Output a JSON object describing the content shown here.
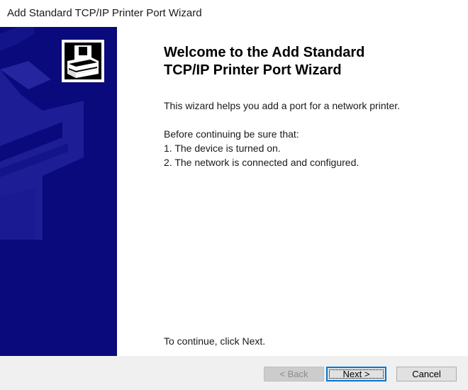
{
  "window": {
    "title": "Add Standard TCP/IP Printer Port Wizard"
  },
  "banner": {
    "color": "#0a0a7c",
    "accent_color": "#1d1d96",
    "icon": "printer-wizard-icon"
  },
  "content": {
    "heading_line1": "Welcome to the Add Standard",
    "heading_line2": "TCP/IP Printer Port Wizard",
    "intro": "This wizard helps you add a port for a network printer.",
    "before_text": "Before continuing be sure that:",
    "checklist": [
      "1.  The device is turned on.",
      "2.  The network is connected and configured."
    ],
    "continue_text": "To continue, click Next."
  },
  "buttons": {
    "back": {
      "label": "< Back",
      "enabled": false
    },
    "next": {
      "label": "Next >",
      "enabled": true,
      "default": true
    },
    "cancel": {
      "label": "Cancel",
      "enabled": true
    }
  }
}
